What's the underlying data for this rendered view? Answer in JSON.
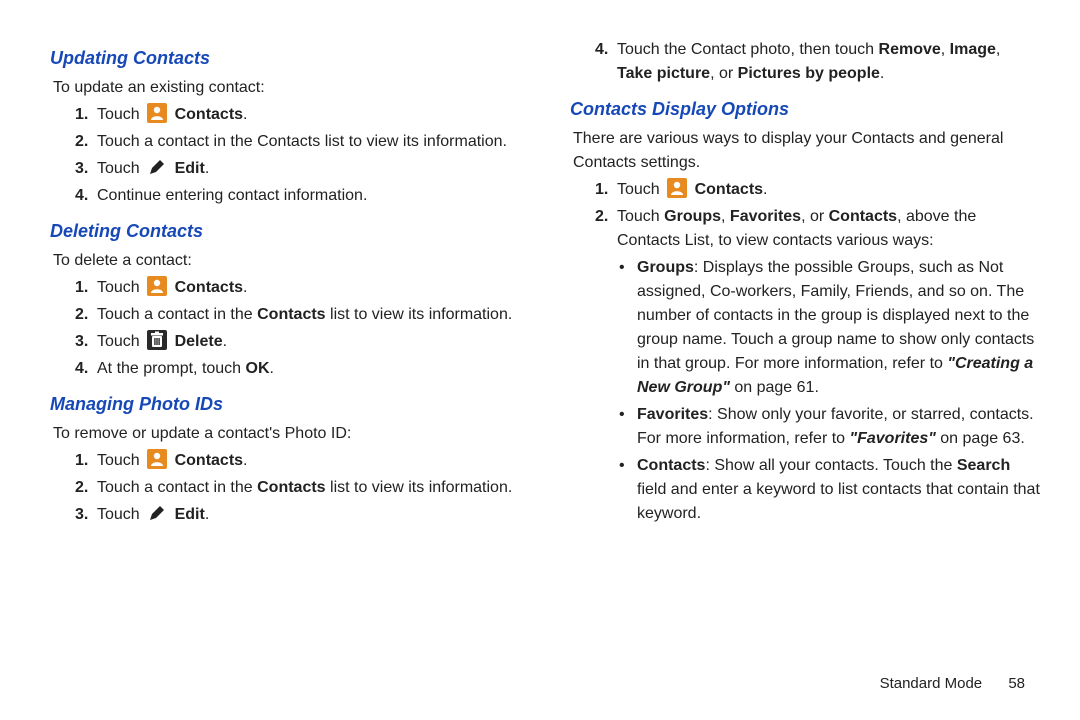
{
  "left": {
    "sec1": {
      "heading": "Updating Contacts",
      "intro": "To update an existing contact:",
      "items": [
        {
          "num": "1.",
          "pre": "Touch ",
          "icon": "contacts",
          "post": "Contacts",
          "tail": "."
        },
        {
          "num": "2.",
          "text": "Touch a contact in the Contacts list to view its information."
        },
        {
          "num": "3.",
          "pre": "Touch ",
          "icon": "edit",
          "post": "Edit",
          "tail": "."
        },
        {
          "num": "4.",
          "text": "Continue entering contact information."
        }
      ]
    },
    "sec2": {
      "heading": "Deleting Contacts",
      "intro": "To delete a contact:",
      "items": [
        {
          "num": "1.",
          "pre": "Touch ",
          "icon": "contacts",
          "post": "Contacts",
          "tail": "."
        },
        {
          "num": "2.",
          "pre": "Touch a contact in the ",
          "bold": "Contacts",
          "post2": " list to view its information."
        },
        {
          "num": "3.",
          "pre": "Touch  ",
          "icon": "delete",
          "post": "Delete",
          "tail": "."
        },
        {
          "num": "4.",
          "pre": "At the prompt, touch ",
          "bold": "OK",
          "post2": "."
        }
      ]
    },
    "sec3": {
      "heading": "Managing Photo IDs",
      "intro": "To remove or update a contact's Photo ID:",
      "items": [
        {
          "num": "1.",
          "pre": "Touch ",
          "icon": "contacts",
          "post": "Contacts",
          "tail": "."
        },
        {
          "num": "2.",
          "pre": "Touch a contact in the ",
          "bold": "Contacts",
          "post2": " list to view its information."
        },
        {
          "num": "3.",
          "pre": "Touch ",
          "icon": "edit",
          "post": "Edit",
          "tail": "."
        }
      ]
    }
  },
  "right": {
    "cont4": {
      "num": "4.",
      "t1": "Touch the Contact photo, then touch ",
      "b1": "Remove",
      "t2": ", ",
      "b2": "Image",
      "t3": ", ",
      "b3": "Take picture",
      "t4": ", or ",
      "b4": "Pictures by people",
      "t5": "."
    },
    "sec4": {
      "heading": "Contacts Display Options",
      "intro": "There are various ways to display your Contacts and general Contacts settings.",
      "item1": {
        "num": "1.",
        "pre": "Touch ",
        "post": "Contacts",
        "tail": "."
      },
      "item2": {
        "num": "2.",
        "t1": "Touch ",
        "b1": "Groups",
        "t2": ", ",
        "b2": "Favorites",
        "t3": ", or ",
        "b3": "Contacts",
        "t4": ", above the Contacts List, to view contacts various ways:"
      },
      "bullets": {
        "b1": {
          "lead": "Groups",
          "t1": ": Displays the possible Groups, such as Not assigned, Co-workers, Family, Friends, and so on. The number of contacts in the group is displayed next to the group name. Touch a group name to show only contacts in that group. For more information, refer to ",
          "ref": "\"Creating a New Group\"",
          "t2": " on page 61."
        },
        "b2": {
          "lead": "Favorites",
          "t1": ": Show only your favorite, or starred, contacts. For more information, refer to ",
          "ref": "\"Favorites\"",
          "t2": " on page 63."
        },
        "b3": {
          "lead": "Contacts",
          "t1": ": Show all your contacts. Touch the ",
          "bmid": "Search",
          "t2": " field and enter a keyword to list contacts that contain that keyword."
        }
      }
    }
  },
  "footer": {
    "mode": "Standard Mode",
    "page": "58"
  }
}
